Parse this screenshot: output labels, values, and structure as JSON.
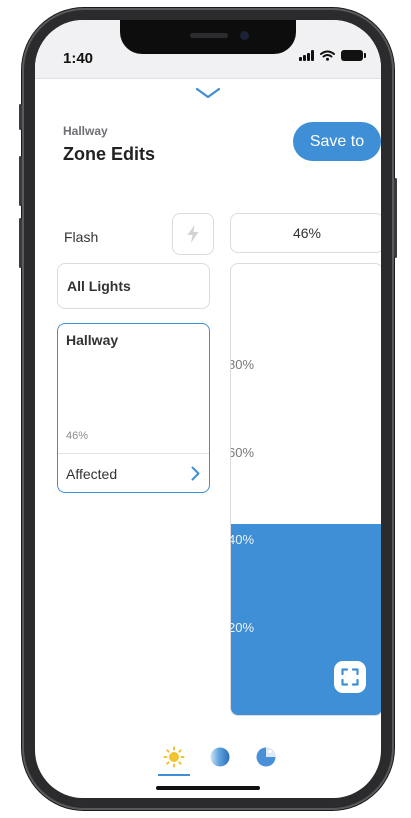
{
  "status_bar": {
    "time": "1:40"
  },
  "header": {
    "breadcrumb": "Hallway",
    "title": "Zone Edits",
    "save_label": "Save to"
  },
  "controls": {
    "flash_label": "Flash",
    "level_value": "46%",
    "all_lights_label": "All Lights"
  },
  "zone_card": {
    "name": "Hallway",
    "percent": "46%",
    "affected_label": "Affected"
  },
  "slider": {
    "level_percent": 46,
    "ticks": [
      "80%",
      "60%",
      "40%",
      "20%"
    ]
  },
  "tabs": [
    {
      "icon": "sun-icon",
      "selected": true
    },
    {
      "icon": "shade-sphere-icon",
      "selected": false
    },
    {
      "icon": "color-wheel-icon",
      "selected": false
    }
  ],
  "colors": {
    "accent": "#3e8fd6",
    "sun": "#f2c230"
  }
}
